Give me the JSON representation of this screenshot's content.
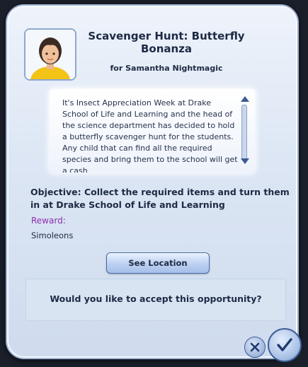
{
  "dialog": {
    "title": "Scavenger Hunt: Butterfly Bonanza",
    "subtitle": "for Samantha Nightmagic",
    "description": "It's Insect Appreciation Week at Drake School of Life and Learning and the head of the science department has decided to hold a butterfly scavenger hunt for the students. Any child that can find all the required species and bring them to the school will get a cash",
    "objective": "Objective: Collect the required items and turn them in at Drake School of Life and Learning",
    "reward_label": "Reward:",
    "reward_value": "Simoleons",
    "location_button": "See Location",
    "question": "Would you like to accept this opportunity?"
  },
  "icons": {
    "portrait": "sim-portrait-icon",
    "close": "close-icon",
    "accept": "checkmark-icon",
    "scroll_up": "scroll-up-icon",
    "scroll_down": "scroll-down-icon"
  },
  "colors": {
    "reward_label": "#8a2fb0",
    "text": "#1e2a44",
    "accent_blue": "#3c5a8f"
  }
}
